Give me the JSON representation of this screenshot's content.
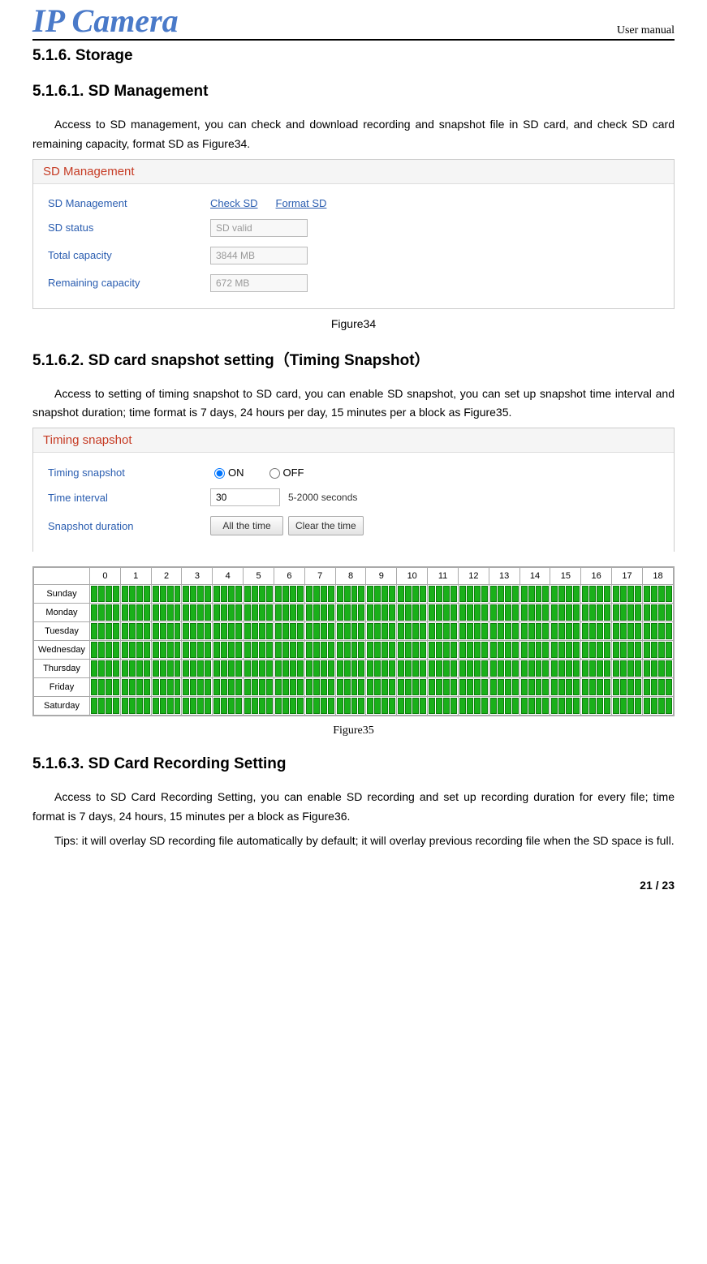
{
  "header": {
    "logo": "IP Camera",
    "right": "User manual"
  },
  "sections": {
    "storage_heading": "5.1.6.  Storage",
    "sd_mgmt_heading": "5.1.6.1. SD Management",
    "sd_mgmt_body": "Access to SD management, you can check and download recording and snapshot file in SD card, and check SD card remaining capacity, format SD as Figure34.",
    "figure34": "Figure34",
    "snapshot_heading": "5.1.6.2. SD card snapshot setting（Timing Snapshot）",
    "snapshot_body": "Access to setting of timing snapshot to SD card, you can enable SD snapshot, you can set up snapshot time interval and snapshot duration; time format is 7 days, 24 hours per day, 15 minutes per a block as Figure35.",
    "figure35": "Figure35",
    "recording_heading": "5.1.6.3. SD Card Recording Setting",
    "recording_body": "Access to SD Card Recording Setting, you can enable SD recording and set up recording duration for every file; time format is 7 days, 24 hours, 15 minutes per a block as Figure36.",
    "recording_tips": "Tips: it will overlay SD recording file automatically by default; it will overlay previous recording file when the SD space is full."
  },
  "sd_management_panel": {
    "title": "SD Management",
    "rows": {
      "mgmt_label": "SD Management",
      "check_sd": "Check SD",
      "format_sd": "Format SD",
      "status_label": "SD status",
      "status_value": "SD valid",
      "total_label": "Total capacity",
      "total_value": "3844 MB",
      "remain_label": "Remaining capacity",
      "remain_value": "672 MB"
    }
  },
  "timing_panel": {
    "title": "Timing snapshot",
    "rows": {
      "ts_label": "Timing snapshot",
      "on": "ON",
      "off": "OFF",
      "interval_label": "Time interval",
      "interval_value": "30",
      "interval_hint": "5-2000 seconds",
      "duration_label": "Snapshot duration",
      "btn_all": "All the time",
      "btn_clear": "Clear the time"
    }
  },
  "schedule": {
    "hours": [
      "0",
      "1",
      "2",
      "3",
      "4",
      "5",
      "6",
      "7",
      "8",
      "9",
      "10",
      "11",
      "12",
      "13",
      "14",
      "15",
      "16",
      "17",
      "18"
    ],
    "days": [
      "Sunday",
      "Monday",
      "Tuesday",
      "Wednesday",
      "Thursday",
      "Friday",
      "Saturday"
    ],
    "blocks_per_cell": 4,
    "cells_selected": "all"
  },
  "footer": {
    "page": "21 / 23"
  }
}
